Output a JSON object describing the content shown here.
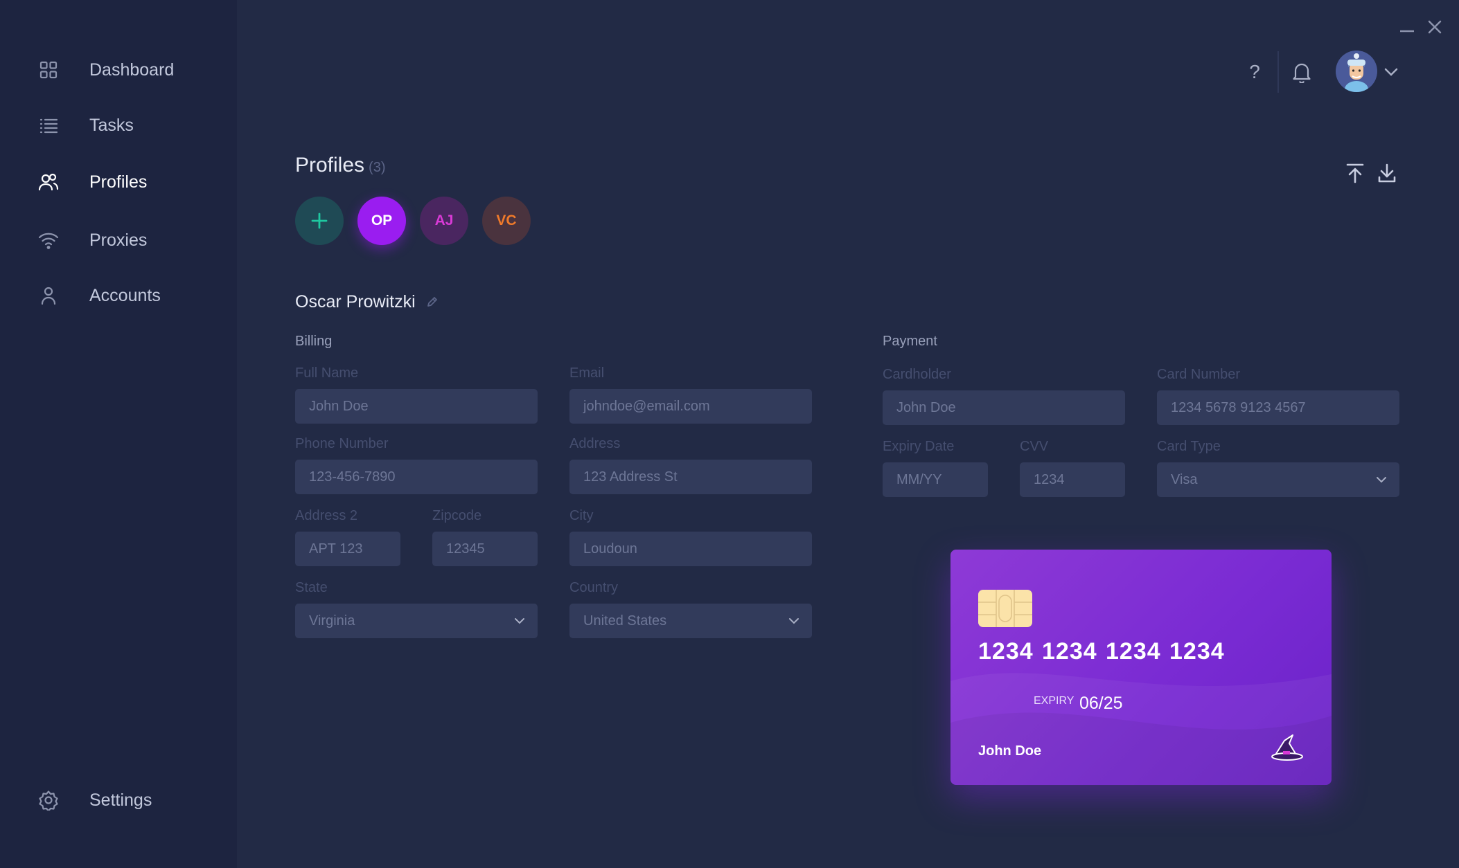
{
  "nav": {
    "items": [
      {
        "label": "Dashboard",
        "icon": "grid-icon"
      },
      {
        "label": "Tasks",
        "icon": "list-icon"
      },
      {
        "label": "Profiles",
        "icon": "users-icon"
      },
      {
        "label": "Proxies",
        "icon": "wifi-icon"
      },
      {
        "label": "Accounts",
        "icon": "user-icon"
      }
    ],
    "settings": {
      "label": "Settings",
      "icon": "gear-icon"
    },
    "active": "Profiles"
  },
  "header": {
    "help_label": "?"
  },
  "profiles": {
    "title": "Profiles",
    "count": "(3)",
    "chips": [
      "OP",
      "AJ",
      "VC"
    ],
    "selected": "OP"
  },
  "profile": {
    "name": "Oscar Prowitzki",
    "billing": {
      "title": "Billing",
      "full_name": {
        "label": "Full Name",
        "value": "John Doe"
      },
      "email": {
        "label": "Email",
        "value": "johndoe@email.com"
      },
      "phone": {
        "label": "Phone Number",
        "value": "123-456-7890"
      },
      "address": {
        "label": "Address",
        "value": "123 Address St"
      },
      "address2": {
        "label": "Address 2",
        "value": "APT 123"
      },
      "zipcode": {
        "label": "Zipcode",
        "value": "12345"
      },
      "city": {
        "label": "City",
        "value": "Loudoun"
      },
      "state": {
        "label": "State",
        "value": "Virginia"
      },
      "country": {
        "label": "Country",
        "value": "United States"
      }
    },
    "payment": {
      "title": "Payment",
      "cardholder": {
        "label": "Cardholder",
        "value": "John Doe"
      },
      "card_number": {
        "label": "Card Number",
        "value": "1234 5678 9123 4567"
      },
      "expiry": {
        "label": "Expiry Date",
        "value": "MM/YY"
      },
      "cvv": {
        "label": "CVV",
        "value": "1234"
      },
      "card_type": {
        "label": "Card Type",
        "value": "Visa"
      }
    }
  },
  "card_preview": {
    "number_groups": [
      "1234",
      "1234",
      "1234",
      "1234"
    ],
    "expiry_label": "EXPIRY",
    "expiry": "06/25",
    "holder": "John Doe"
  },
  "colors": {
    "sidebar_bg": "#1d2440",
    "main_bg": "#222a45",
    "field_bg": "#323b5b",
    "accent_purple": "#9a1df0",
    "add_green": "#1fc8a0",
    "aj_pink": "#d93ad6",
    "vc_orange": "#f07a2a"
  }
}
